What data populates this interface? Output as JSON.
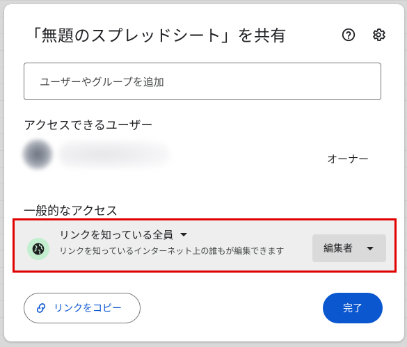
{
  "dialog": {
    "title": "「無題のスプレッドシート」を共有"
  },
  "header_icons": {
    "help": "help-circle-icon",
    "settings": "gear-icon"
  },
  "search": {
    "placeholder": "ユーザーやグループを追加",
    "value": ""
  },
  "people_section": {
    "heading": "アクセスできるユーザー",
    "users": [
      {
        "role": "オーナー"
      }
    ]
  },
  "general_access": {
    "heading": "一般的なアクセス",
    "icon": "globe-icon",
    "selected_option": "リンクを知っている全員",
    "description": "リンクを知っているインターネット上の誰もが編集できます",
    "role": "編集者"
  },
  "footer": {
    "copy_link_label": "リンクをコピー",
    "copy_link_icon": "link-icon",
    "done_label": "完了"
  },
  "colors": {
    "primary": "#0b57d0",
    "highlight_border": "#e00000",
    "globe_bg": "#c4eed0"
  }
}
